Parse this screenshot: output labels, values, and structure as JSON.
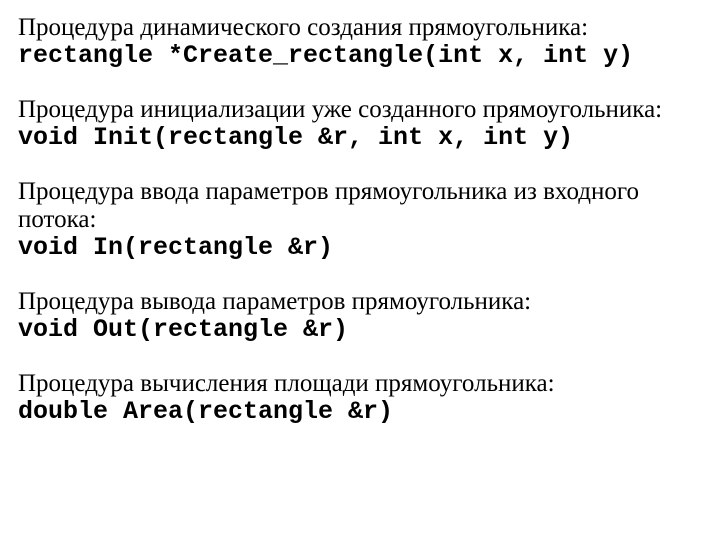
{
  "blocks": [
    {
      "desc": "Процедура динамического создания прямоугольника:",
      "code": "rectangle *Create_rectangle(int x, int y)"
    },
    {
      "desc": "Процедура инициализации уже созданного прямоугольника:",
      "code": "void Init(rectangle &r, int x, int y)"
    },
    {
      "desc": "Процедура ввода параметров прямоугольника из входного потока:",
      "code": "void In(rectangle &r)"
    },
    {
      "desc": "Процедура вывода параметров прямоугольника:",
      "code": "void Out(rectangle &r)"
    },
    {
      "desc": "Процедура вычисления площади прямоугольника:",
      "code": "double Area(rectangle &r)"
    }
  ]
}
